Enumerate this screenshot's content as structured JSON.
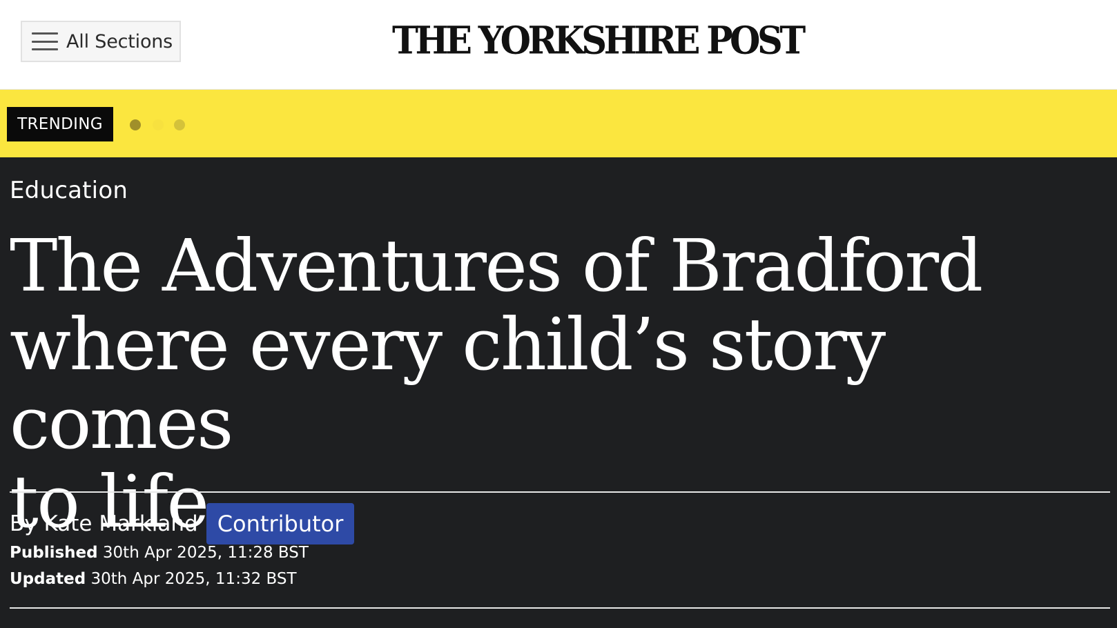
{
  "header": {
    "menu_label": "All Sections",
    "logo_text": "THE YORKSHIRE POST"
  },
  "trending": {
    "label": "TRENDING",
    "dots": 3
  },
  "article": {
    "section": "Education",
    "headline_lines": [
      "The Adventures of Bradford",
      "where every child’s story comes",
      "to life"
    ],
    "byline": "By Kate Markland",
    "author_role": "Contributor",
    "published_label": "Published",
    "published_value": "30th Apr 2025, 11:28 BST",
    "updated_label": "Updated",
    "updated_value": "30th Apr 2025, 11:32 BST"
  },
  "colors": {
    "trending_bar": "#fbe63f",
    "article_bg": "#1e1f21",
    "contributor_badge": "#2e4aa6"
  },
  "icons": {
    "menu": "hamburger-menu-icon"
  }
}
